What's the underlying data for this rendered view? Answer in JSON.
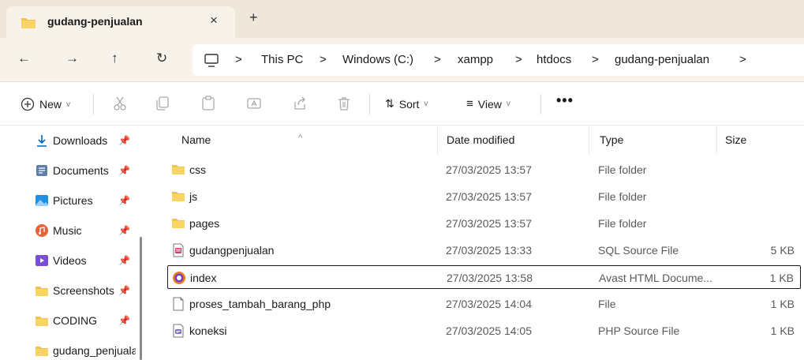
{
  "tab": {
    "title": "gudang-penjualan",
    "close": "×",
    "new": "+"
  },
  "nav": {
    "back": "←",
    "forward": "→",
    "up": "↑",
    "refresh": "↻"
  },
  "breadcrumb": [
    {
      "label": ">"
    },
    {
      "label": "This PC"
    },
    {
      "label": ">"
    },
    {
      "label": "Windows (C:)"
    },
    {
      "label": ">"
    },
    {
      "label": "xampp"
    },
    {
      "label": ">"
    },
    {
      "label": "htdocs"
    },
    {
      "label": ">"
    },
    {
      "label": "gudang-penjualan"
    },
    {
      "label": ">"
    }
  ],
  "commandbar": {
    "new_label": "New",
    "sort_label": "Sort",
    "view_label": "View",
    "more_label": "•••",
    "icons": [
      "cut-icon",
      "copy-icon",
      "paste-icon",
      "rename-icon",
      "share-icon",
      "delete-icon"
    ]
  },
  "sidebar": {
    "items": [
      {
        "label": "Downloads",
        "icon": "download-icon",
        "pinned": true
      },
      {
        "label": "Documents",
        "icon": "documents-icon",
        "pinned": true
      },
      {
        "label": "Pictures",
        "icon": "pictures-icon",
        "pinned": true
      },
      {
        "label": "Music",
        "icon": "music-icon",
        "pinned": true
      },
      {
        "label": "Videos",
        "icon": "videos-icon",
        "pinned": true
      },
      {
        "label": "Screenshots",
        "icon": "folder-icon",
        "pinned": true
      },
      {
        "label": "CODING",
        "icon": "folder-icon",
        "pinned": true
      },
      {
        "label": "gudang_penjualan",
        "icon": "folder-icon",
        "pinned": false
      }
    ],
    "pin_glyph": "📌"
  },
  "columns": {
    "name": "Name",
    "date": "Date modified",
    "type": "Type",
    "size": "Size",
    "sort_caret": "^"
  },
  "files": [
    {
      "name": "css",
      "date": "27/03/2025 13:57",
      "type": "File folder",
      "size": "",
      "icon": "folder-icon"
    },
    {
      "name": "js",
      "date": "27/03/2025 13:57",
      "type": "File folder",
      "size": "",
      "icon": "folder-icon"
    },
    {
      "name": "pages",
      "date": "27/03/2025 13:57",
      "type": "File folder",
      "size": "",
      "icon": "folder-icon"
    },
    {
      "name": "gudangpenjualan",
      "date": "27/03/2025 13:33",
      "type": "SQL Source File",
      "size": "5 KB",
      "icon": "sql-file-icon"
    },
    {
      "name": "index",
      "date": "27/03/2025 13:58",
      "type": "Avast HTML Docume...",
      "size": "1 KB",
      "icon": "avast-html-icon",
      "selected": true
    },
    {
      "name": "proses_tambah_barang_php",
      "date": "27/03/2025 14:04",
      "type": "File",
      "size": "1 KB",
      "icon": "blank-file-icon"
    },
    {
      "name": "koneksi",
      "date": "27/03/2025 14:05",
      "type": "PHP Source File",
      "size": "1 KB",
      "icon": "php-file-icon"
    }
  ],
  "colors": {
    "folder": "#f2c14e",
    "accent": "#0067c0",
    "chrome": "#efe7da"
  }
}
